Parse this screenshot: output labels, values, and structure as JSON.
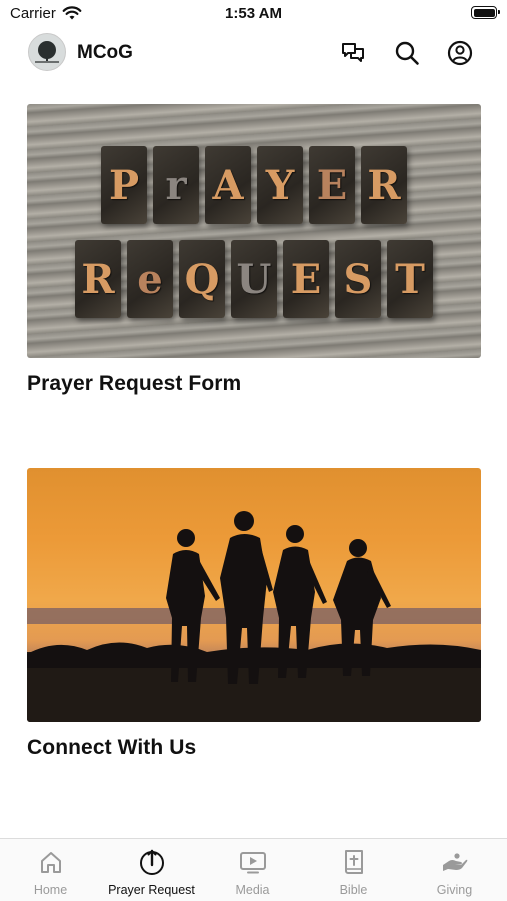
{
  "status_bar": {
    "carrier": "Carrier",
    "time": "1:53 AM"
  },
  "header": {
    "title": "MCoG"
  },
  "cards": [
    {
      "title": "Prayer Request Form",
      "image_line1": [
        "P",
        "r",
        "A",
        "Y",
        "E",
        "R"
      ],
      "image_line2": [
        "R",
        "e",
        "Q",
        "U",
        "E",
        "S",
        "T"
      ]
    },
    {
      "title": "Connect With Us"
    }
  ],
  "tab_bar": {
    "tabs": [
      {
        "label": "Home",
        "icon": "home-icon",
        "active": false
      },
      {
        "label": "Prayer Request",
        "icon": "prayer-hands-icon",
        "active": true
      },
      {
        "label": "Media",
        "icon": "media-play-icon",
        "active": false
      },
      {
        "label": "Bible",
        "icon": "bible-icon",
        "active": false
      },
      {
        "label": "Giving",
        "icon": "giving-hand-icon",
        "active": false
      }
    ]
  },
  "colors": {
    "active_tab": "#111111",
    "inactive_tab": "#9a9a9a",
    "background": "#ffffff"
  }
}
